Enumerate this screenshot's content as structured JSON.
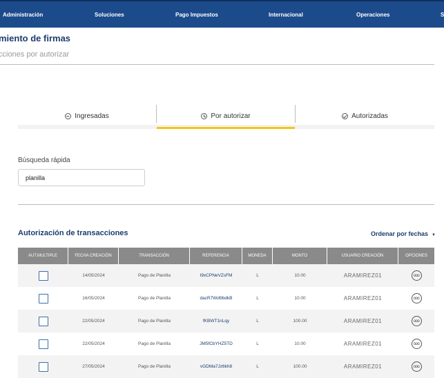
{
  "topnav": {
    "items": [
      "Administración",
      "Soluciones",
      "Pago Impuestos",
      "Internacional",
      "Operaciones",
      "S"
    ]
  },
  "page": {
    "title": "miento de firmas",
    "subtitle": "cciones por autorizar"
  },
  "tabs": [
    {
      "label": "Ingresadas",
      "icon": "arrow-circle-icon"
    },
    {
      "label": "Por autorizar",
      "icon": "clock-icon",
      "active": true
    },
    {
      "label": "Autorizadas",
      "icon": "check-circle-icon"
    }
  ],
  "search": {
    "label": "Búsqueda rápida",
    "value": "planilla"
  },
  "section": {
    "title": "Autorización de transacciones",
    "sort_label": "Ordenar por fechas",
    "sort_caret": "▼"
  },
  "table": {
    "headers": [
      "AUT.MULTIPLE",
      "FECHA CREACIÓN",
      "TRANSACCIÓN",
      "REFERENCIA",
      "MONEDA",
      "MONTO",
      "USUARIO CREACIÓN",
      "OPCIONES"
    ],
    "rows": [
      {
        "fecha": "14/05/2024",
        "transaccion": "Pago de Planilla",
        "referencia": "I9xCPNeVZsFM",
        "moneda": "L",
        "monto": "10.00",
        "usuario": "ARAMIREZ01",
        "opciones": "ooo"
      },
      {
        "fecha": "16/05/2024",
        "transaccion": "Pago de Planilla",
        "referencia": "dacR7Wd9bdkB",
        "moneda": "L",
        "monto": "10.00",
        "usuario": "ARAMIREZ01",
        "opciones": "ooo"
      },
      {
        "fecha": "22/05/2024",
        "transaccion": "Pago de Planilla",
        "referencia": "fKBWT1nLqy",
        "moneda": "L",
        "monto": "100.00",
        "usuario": "ARAMIREZ01",
        "opciones": "ooo"
      },
      {
        "fecha": "22/05/2024",
        "transaccion": "Pago de Planilla",
        "referencia": "JM5fCbYHZ5TD",
        "moneda": "L",
        "monto": "10.00",
        "usuario": "ARAMIREZ01",
        "opciones": "ooo"
      },
      {
        "fecha": "27/05/2024",
        "transaccion": "Pago de Planilla",
        "referencia": "vGDMa7Jz6kh8",
        "moneda": "L",
        "monto": "100.00",
        "usuario": "ARAMIREZ01",
        "opciones": "ooo"
      }
    ]
  },
  "colors": {
    "nav_bg": "#1c4b8c",
    "accent_yellow": "#f2c516",
    "title_blue": "#1c3c6e",
    "header_gray": "#8a8a8a"
  }
}
